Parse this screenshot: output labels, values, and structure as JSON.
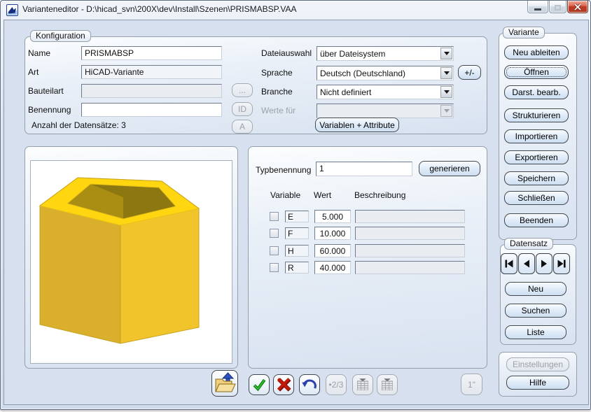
{
  "window": {
    "title": "Varianteneditor - D:\\hicad_svn\\200X\\dev\\Install\\Szenen\\PRISMABSP.VAA",
    "controls": {
      "minimize": "minimize",
      "maximize": "maximize",
      "close": "close"
    }
  },
  "konfiguration": {
    "caption": "Konfiguration",
    "name_label": "Name",
    "name_value": "PRISMABSP",
    "art_label": "Art",
    "art_value": "HiCAD-Variante",
    "bauteilart_label": "Bauteilart",
    "bauteilart_value": "",
    "benennung_label": "Benennung",
    "benennung_value": "",
    "anzahl_text": "Anzahl der Datensätze: 3",
    "browse_button": "...",
    "id_button": "ID",
    "a_button": "A",
    "right": {
      "dateiauswahl_label": "Dateiauswahl",
      "dateiauswahl_value": "über Dateisystem",
      "sprache_label": "Sprache",
      "sprache_value": "Deutsch (Deutschland)",
      "plusminus_button": "+/-",
      "branche_label": "Branche",
      "branche_value": "Nicht definiert",
      "wertefuer_label": "Werte für",
      "wertefuer_value": "",
      "variablen_attribute_button": "Variablen + Attribute"
    }
  },
  "typ": {
    "typbenennung_label": "Typbenennung",
    "typbenennung_value": "1",
    "generieren_button": "generieren",
    "table": {
      "headers": [
        "Variable",
        "Wert",
        "Beschreibung"
      ],
      "rows": [
        {
          "checked": false,
          "variable": "E",
          "wert": "5.000",
          "beschreibung": ""
        },
        {
          "checked": false,
          "variable": "F",
          "wert": "10.000",
          "beschreibung": ""
        },
        {
          "checked": false,
          "variable": "H",
          "wert": "60.000",
          "beschreibung": ""
        },
        {
          "checked": false,
          "variable": "R",
          "wert": "40.000",
          "beschreibung": ""
        }
      ]
    }
  },
  "variante": {
    "caption": "Variante",
    "buttons": [
      "Neu ableiten",
      "Öffnen",
      "Darst. bearb.",
      "Strukturieren",
      "Importieren",
      "Exportieren",
      "Speichern",
      "Schließen",
      "Beenden"
    ],
    "focused_button": "Öffnen"
  },
  "datensatz": {
    "caption": "Datensatz",
    "nav": [
      "first",
      "previous",
      "next",
      "last"
    ],
    "neu_button": "Neu",
    "suchen_button": "Suchen",
    "liste_button": "Liste"
  },
  "footer": {
    "einstellungen_button": "Einstellungen",
    "hilfe_button": "Hilfe"
  },
  "toolbar": {
    "icons": [
      "folder-upload",
      "apply-check",
      "cancel-x",
      "undo-arrow",
      "ratio-2-3",
      "table-view",
      "table-view",
      "one-inch"
    ],
    "ratio_button": "•2/3",
    "inch_button": "1\""
  },
  "preview": {
    "content": "yellow hollow pentagonal prism 3D model"
  },
  "colors": {
    "client_bg": "#D6E0EF",
    "close_button_red": "#C13A24",
    "prism_top": "#FFD60F",
    "prism_left": "#D9AF2B",
    "prism_right": "#F2C42C",
    "prism_hole_dark": "#8C7711",
    "check_green": "#17A317",
    "cancel_red": "#C21807",
    "undo_blue": "#2B3FAE",
    "folder_yellow": "#F2D186"
  }
}
